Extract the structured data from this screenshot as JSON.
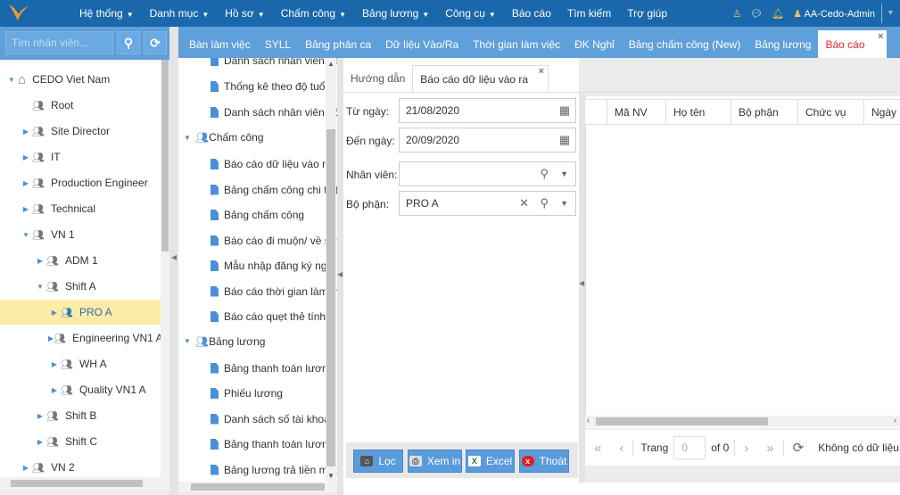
{
  "topbar": {
    "menu": [
      {
        "label": "Hệ thống",
        "dropdown": true
      },
      {
        "label": "Danh mục",
        "dropdown": true
      },
      {
        "label": "Hồ sơ",
        "dropdown": true
      },
      {
        "label": "Chấm công",
        "dropdown": true
      },
      {
        "label": "Bảng lương",
        "dropdown": true
      },
      {
        "label": "Công cụ",
        "dropdown": true
      },
      {
        "label": "Báo cáo",
        "dropdown": false
      },
      {
        "label": "Tìm kiếm",
        "dropdown": false
      },
      {
        "label": "Trợ giúp",
        "dropdown": false
      }
    ],
    "user": "AA-Cedo-Admin",
    "brand_color": "#1a68ab"
  },
  "left": {
    "search_placeholder": "Tìm nhân viên...",
    "tree": [
      {
        "label": "CEDO Viet Nam",
        "level": 0,
        "icon": "home-icon",
        "expanded": true
      },
      {
        "label": "Root",
        "level": 1,
        "icon": "group-icon"
      },
      {
        "label": "Site Director",
        "level": 1,
        "icon": "group-icon",
        "arrow": "right"
      },
      {
        "label": "IT",
        "level": 1,
        "icon": "group-icon",
        "arrow": "right"
      },
      {
        "label": "Production Engineer",
        "level": 1,
        "icon": "group-icon",
        "arrow": "right"
      },
      {
        "label": "Technical",
        "level": 1,
        "icon": "group-icon",
        "arrow": "right"
      },
      {
        "label": "VN 1",
        "level": 1,
        "icon": "group-icon",
        "arrow": "down"
      },
      {
        "label": "ADM 1",
        "level": 2,
        "icon": "group-icon",
        "arrow": "right"
      },
      {
        "label": "Shift A",
        "level": 2,
        "icon": "group-icon",
        "arrow": "down"
      },
      {
        "label": "PRO A",
        "level": 3,
        "icon": "group-icon",
        "arrow": "right",
        "selected": true
      },
      {
        "label": "Engineering VN1 A",
        "level": 3,
        "icon": "group-icon",
        "arrow": "right"
      },
      {
        "label": "WH A",
        "level": 3,
        "icon": "group-icon",
        "arrow": "right"
      },
      {
        "label": "Quality VN1 A",
        "level": 3,
        "icon": "group-icon",
        "arrow": "right"
      },
      {
        "label": "Shift B",
        "level": 2,
        "icon": "group-icon",
        "arrow": "right"
      },
      {
        "label": "Shift C",
        "level": 2,
        "icon": "group-icon",
        "arrow": "right"
      },
      {
        "label": "VN 2",
        "level": 1,
        "icon": "group-icon",
        "arrow": "right"
      }
    ]
  },
  "tabs": [
    "Bàn làm việc",
    "SYLL",
    "Bảng phân ca",
    "Dữ liệu Vào/Ra",
    "Thời gian làm việc",
    "ĐK Nghỉ",
    "Bảng chấm công (New)",
    "Bảng lương",
    "Báo cáo"
  ],
  "active_tab": "Báo cáo",
  "reports": {
    "items_top": [
      "Danh sách nhân viên đang",
      "Thống kê theo độ tuổi",
      "Danh sách nhân viên công"
    ],
    "groups": [
      {
        "label": "Chấm công",
        "items": [
          "Báo cáo dữ liệu vào ra",
          "Bảng chấm công chi tiết",
          "Bảng chấm công",
          "Báo cáo đi muộn/ về sớm",
          "Mẫu nhập đăng ký nghỉ",
          "Báo cáo thời gian làm thê",
          "Báo cáo quẹt thẻ tính giờ"
        ]
      },
      {
        "label": "Bảng lương",
        "items": [
          "Bảng thanh toán lương",
          "Phiếu lương",
          "Danh sách số tài khoản ng",
          "Bảng thanh toán lương th",
          "Bảng lương trả tiền mặt"
        ]
      }
    ]
  },
  "subtabs": [
    "Hướng dẫn",
    "Báo cáo dữ liệu vào ra"
  ],
  "form": {
    "from_label": "Từ ngày:",
    "from_value": "21/08/2020",
    "to_label": "Đến ngày:",
    "to_value": "20/09/2020",
    "employee_label": "Nhân viên:",
    "employee_value": "",
    "dept_label": "Bộ phận:",
    "dept_value": "PRO A"
  },
  "buttons": {
    "filter": "Lọc",
    "print": "Xem in",
    "excel": "Excel",
    "exit": "Thoát"
  },
  "grid": {
    "columns": [
      "",
      "Mã NV",
      "Họ tên",
      "Bộ phận",
      "Chức vụ",
      "Ngày"
    ]
  },
  "pager": {
    "page_label": "Trang",
    "page_value": "0",
    "of_label": "of 0",
    "status": "Không có dữ liệu"
  }
}
